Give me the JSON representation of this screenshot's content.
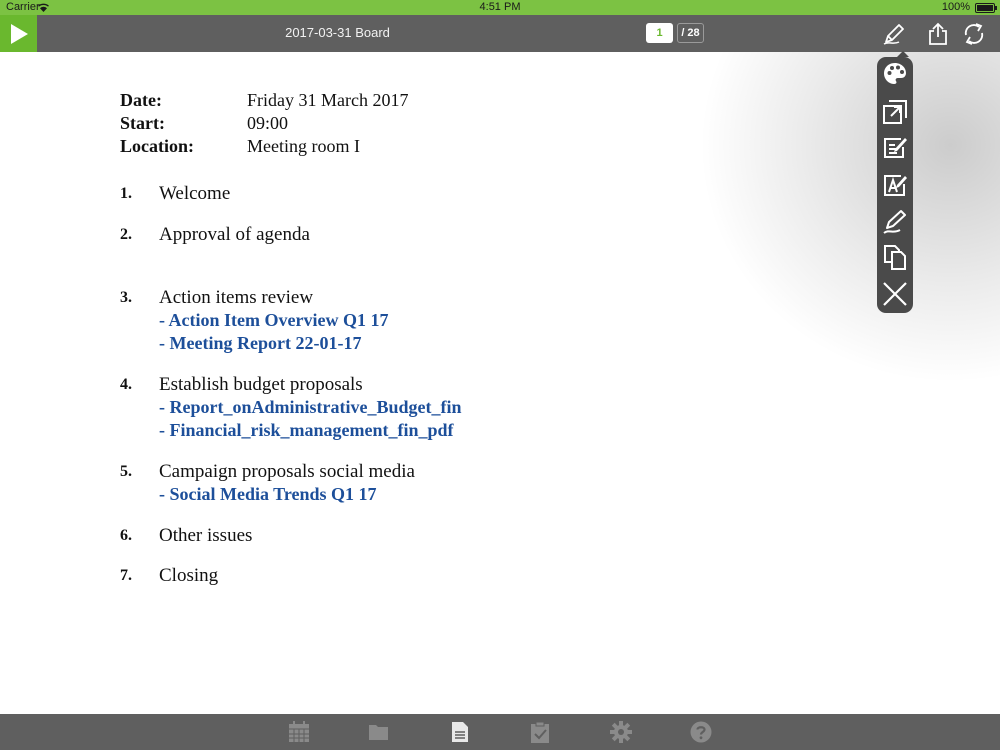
{
  "status_bar": {
    "carrier": "Carrier",
    "time": "4:51 PM",
    "battery": "100%"
  },
  "toolbar": {
    "title": "2017-03-31 Board",
    "current_page": "1",
    "total_pages": "/ 28"
  },
  "meeting": {
    "date_label": "Date:",
    "date_value": "Friday 31 March 2017",
    "start_label": "Start:",
    "start_value": "09:00",
    "location_label": "Location:",
    "location_value": "Meeting room I"
  },
  "agenda": [
    {
      "num": "1.",
      "title": "Welcome",
      "links": []
    },
    {
      "num": "2.",
      "title": "Approval of agenda",
      "links": []
    },
    {
      "num": "3.",
      "title": "Action items review",
      "links": [
        "- Action Item Overview Q1 17",
        "- Meeting Report 22-01-17"
      ]
    },
    {
      "num": "4.",
      "title": "Establish budget proposals",
      "links": [
        "- Report_onAdministrative_Budget_fin",
        "- Financial_risk_management_fin_pdf"
      ]
    },
    {
      "num": "5.",
      "title": "Campaign proposals social media",
      "links": [
        "- Social Media Trends Q1 17"
      ]
    },
    {
      "num": "6.",
      "title": "Other issues",
      "links": []
    },
    {
      "num": "7.",
      "title": "Closing",
      "links": []
    }
  ],
  "colors": {
    "accent_green": "#6ab82e",
    "status_green": "#7cc243",
    "toolbar_gray": "#5f5f5f",
    "link_blue": "#1d4f9a",
    "menu_dark": "#4a4a4a"
  },
  "icons": {
    "toolbar": [
      "play-icon",
      "pen-icon",
      "share-icon",
      "sync-icon"
    ],
    "floating_menu": [
      "palette-icon",
      "export-icon",
      "edit-note-icon",
      "text-annotate-icon",
      "signature-icon",
      "copy-icon",
      "close-icon"
    ],
    "bottom_bar": [
      "calendar-icon",
      "folder-icon",
      "document-icon",
      "clipboard-check-icon",
      "gear-icon",
      "help-icon"
    ]
  }
}
